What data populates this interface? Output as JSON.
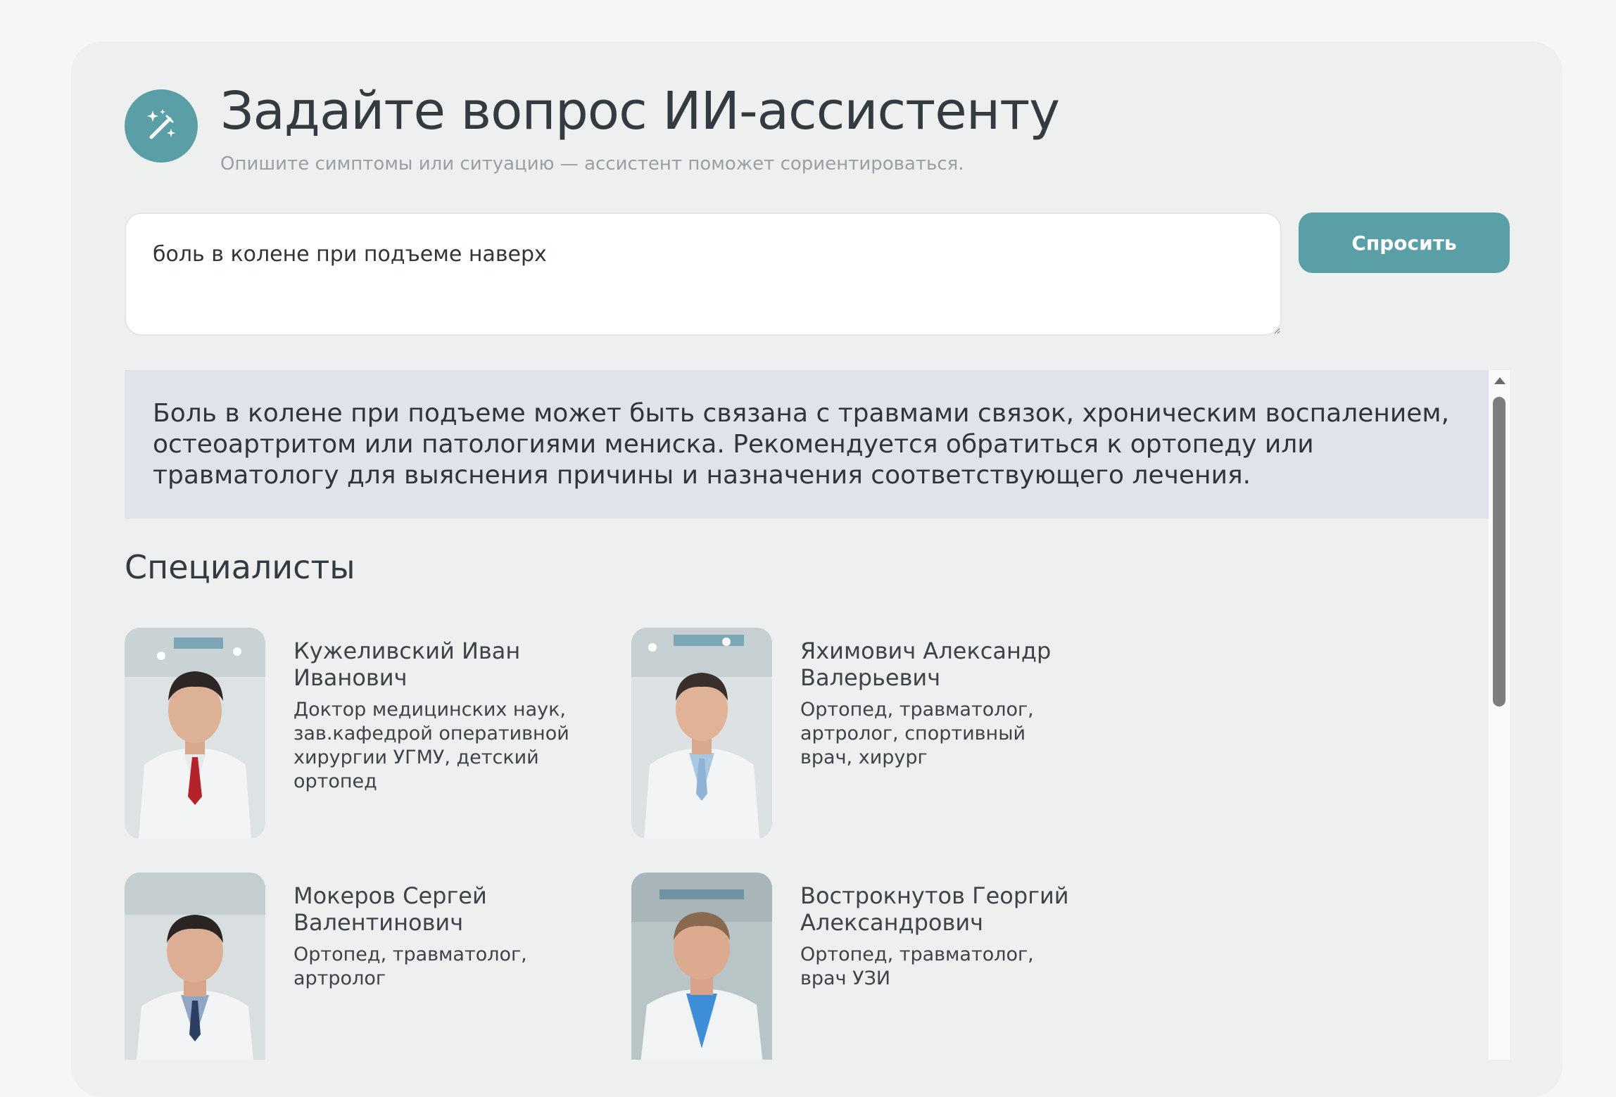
{
  "header": {
    "icon": "magic-wand-icon",
    "title": "Задайте вопрос ИИ-ассистенту",
    "subtitle": "Опишите симптомы или ситуацию — ассистент поможет сориентироваться."
  },
  "query": {
    "value": "боль в колене при подъеме наверх"
  },
  "ask_button": {
    "label": "Спросить"
  },
  "answer": {
    "text": "Боль в колене при подъеме может быть связана с травмами связок, хроническим воспалением, остеоартритом или патологиями мениска. Рекомендуется обратиться к ортопеду или травматологу для выяснения причины и назначения соответствующего лечения."
  },
  "specialists": {
    "title": "Специалисты",
    "items": [
      {
        "name": "Кужеливский Иван Иванович",
        "desc": "Доктор медицинских наук, зав.кафедрой оперативной хирургии УГМУ, детский ортопед"
      },
      {
        "name": "Яхимович Александр Валерьевич",
        "desc": "Ортопед, травматолог, артролог, спортивный врач, хирург"
      },
      {
        "name": "Мокеров Сергей Валентинович",
        "desc": "Ортопед, травматолог, артролог"
      },
      {
        "name": "Вострокнутов Георгий Александрович",
        "desc": "Ортопед, травматолог, врач УЗИ"
      }
    ]
  },
  "colors": {
    "accent": "#5a9fa6",
    "answer_bg": "#e1e3eb",
    "card_bg": "#eef0f0"
  }
}
